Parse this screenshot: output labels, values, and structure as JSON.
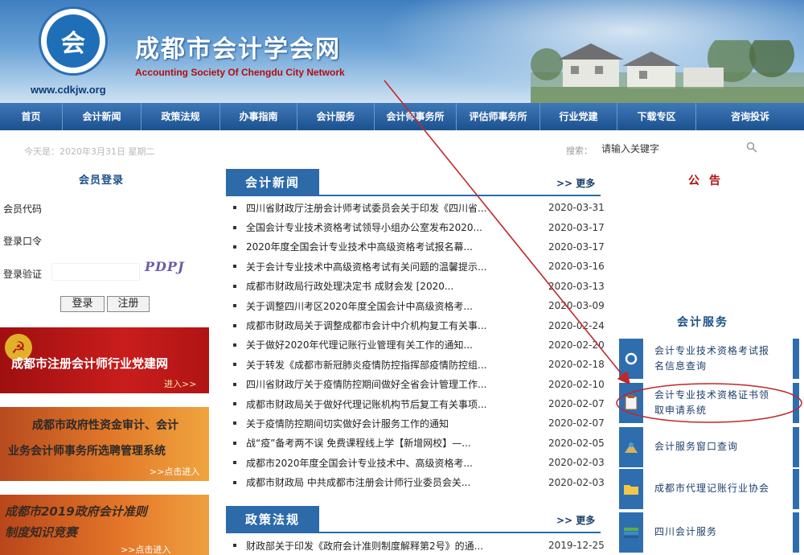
{
  "header": {
    "title": "成都市会计学会网",
    "subtitle": "Accounting Society Of Chengdu City Network",
    "url": "www.cdkjw.org",
    "logo_icon": "society-seal-icon"
  },
  "nav": {
    "items": [
      "首页",
      "会计新闻",
      "政策法规",
      "办事指南",
      "会计服务",
      "会计师事务所",
      "评估师事务所",
      "行业党建",
      "下载专区",
      "咨询投诉"
    ]
  },
  "topbar": {
    "date": "今天是：2020年3月31日 星期二",
    "search_label": "搜索：",
    "search_placeholder": "请输入关键字",
    "search_icon": "magnifier-icon"
  },
  "login": {
    "title": "会员登录",
    "code_label": "会员代码",
    "password_label": "登录口令",
    "captcha_label": "登录验证",
    "captcha_text": "PDPJ",
    "login_btn": "登录",
    "register_btn": "注册"
  },
  "banners": {
    "b1_text": "成都市注册会计师行业党建网",
    "b1_enter": "进入>>",
    "b2_line1": "成都市政府性资金审计、会计",
    "b2_line2": "业务会计师事务所选聘管理系统",
    "b2_enter": ">>点击进入",
    "b3_line1": "成都市2019政府会计准则",
    "b3_line2": "制度知识竞赛",
    "b3_enter": ">>点击进入"
  },
  "news": {
    "tab": "会计新闻",
    "more": ">> 更多",
    "items": [
      {
        "title": "四川省财政厅注册会计师考试委员会关于印发《四川省...",
        "date": "2020-03-31"
      },
      {
        "title": "全国会计专业技术资格考试领导小组办公室发布2020...",
        "date": "2020-03-17"
      },
      {
        "title": "2020年度全国会计专业技术中高级资格考试报名幕...",
        "date": "2020-03-17"
      },
      {
        "title": "关于会计专业技术中高级资格考试有关问题的温馨提示...",
        "date": "2020-03-16"
      },
      {
        "title": "成都市财政局行政处理决定书 成财会发 [2020...",
        "date": "2020-03-13"
      },
      {
        "title": "关于调整四川考区2020年度全国会计中高级资格考...",
        "date": "2020-03-09"
      },
      {
        "title": "成都市财政局关于调整成都市会计中介机构复工有关事...",
        "date": "2020-02-24"
      },
      {
        "title": "关于做好2020年代理记账行业管理有关工作的通知...",
        "date": "2020-02-20"
      },
      {
        "title": "关于转发《成都市新冠肺炎疫情防控指挥部疫情防控组...",
        "date": "2020-02-18"
      },
      {
        "title": "四川省财政厅关于疫情防控期间做好全省会计管理工作...",
        "date": "2020-02-10"
      },
      {
        "title": "成都市财政局关于做好代理记账机构节后复工有关事项...",
        "date": "2020-02-07"
      },
      {
        "title": "关于疫情防控期间切实做好会计服务工作的通知",
        "date": "2020-02-07"
      },
      {
        "title": "战“疫”备考两不误 免费课程线上学【新增网校】—...",
        "date": "2020-02-05"
      },
      {
        "title": "成都市2020年度全国会计专业技术中、高级资格考...",
        "date": "2020-02-03"
      },
      {
        "title": "成都市财政局 中共成都市注册会计师行业委员会关...",
        "date": "2020-02-03"
      }
    ]
  },
  "policy": {
    "tab": "政策法规",
    "more": ">> 更多",
    "items": [
      {
        "title": "财政部关于印发《政府会计准则制度解释第2号》的通...",
        "date": "2019-12-25"
      }
    ]
  },
  "right": {
    "notice_title": "公告",
    "services_title": "会计服务",
    "services": [
      {
        "line1": "会计专业技术资格考试报",
        "line2": "名信息查询",
        "icon": "search-circle-icon"
      },
      {
        "line1": "会计专业技术资格证书领",
        "line2": "取申请系统",
        "icon": "certificate-icon"
      },
      {
        "line1": "会计服务窗口查询",
        "line2": "",
        "icon": "window-icon"
      },
      {
        "line1": "成都市代理记账行业协会",
        "line2": "",
        "icon": "folder-icon"
      },
      {
        "line1": "四川会计服务",
        "line2": "",
        "icon": "books-icon"
      }
    ]
  },
  "colors": {
    "nav_bg": "#1d518f",
    "accent_blue": "#2c6aaa",
    "notice_red": "#b01010",
    "annotation_red": "#c0282a"
  }
}
